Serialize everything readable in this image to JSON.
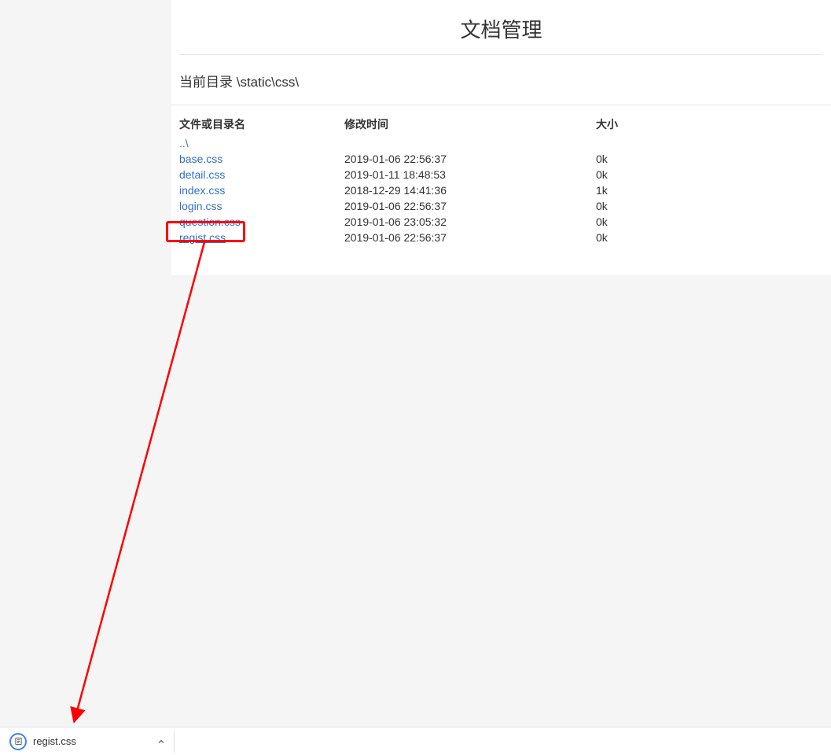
{
  "pageTitle": "文档管理",
  "currentDirLabel": "当前目录 \\static\\css\\",
  "headers": {
    "name": "文件或目录名",
    "time": "修改时间",
    "size": "大小"
  },
  "parentLink": "..\\",
  "files": [
    {
      "name": "base.css",
      "time": "2019-01-06 22:56:37",
      "size": "0k"
    },
    {
      "name": "detail.css",
      "time": "2019-01-11 18:48:53",
      "size": "0k"
    },
    {
      "name": "index.css",
      "time": "2018-12-29 14:41:36",
      "size": "1k"
    },
    {
      "name": "login.css",
      "time": "2019-01-06 22:56:37",
      "size": "0k"
    },
    {
      "name": "question.css",
      "time": "2019-01-06 23:05:32",
      "size": "0k"
    },
    {
      "name": "regist.css",
      "time": "2019-01-06 22:56:37",
      "size": "0k"
    }
  ],
  "highlightedIndex": 5,
  "download": {
    "fileName": "regist.css"
  }
}
